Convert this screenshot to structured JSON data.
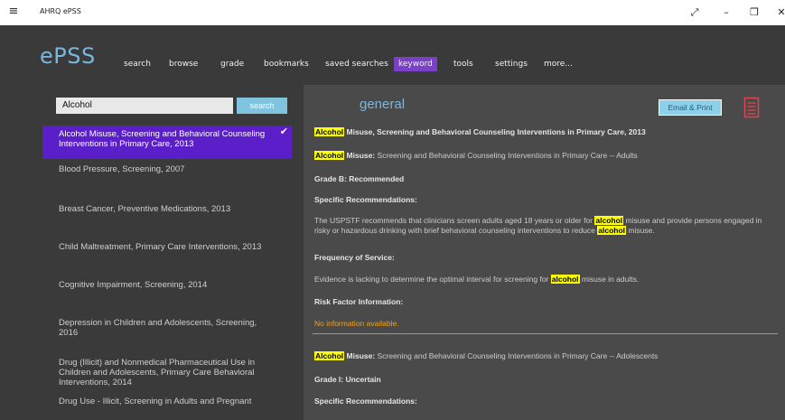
{
  "window": {
    "title": "AHRQ ePSS",
    "menu_glyph": "≡",
    "controls": {
      "expand": "⤢",
      "minimize": "–",
      "restore": "❐",
      "close": "✕"
    }
  },
  "app": {
    "logo": "ePSS",
    "nav": [
      "search",
      "browse",
      "grade",
      "bookmarks",
      "saved searches",
      "keyword",
      "tools",
      "settings",
      "more..."
    ],
    "active_nav": "keyword"
  },
  "search": {
    "value": "Alcohol",
    "button_label": "search"
  },
  "results": [
    {
      "title": "Alcohol Misuse, Screening and Behavioral Counseling Interventions in Primary Care, 2013",
      "selected": true
    },
    {
      "title": "Blood Pressure, Screening, 2007",
      "selected": false
    },
    {
      "title": "Breast Cancer, Preventive Medications, 2013",
      "selected": false
    },
    {
      "title": "Child Maltreatment, Primary Care Interventions, 2013",
      "selected": false
    },
    {
      "title": "Cognitive Impairment, Screening, 2014",
      "selected": false
    },
    {
      "title": "Depression in Children and Adolescents, Screening, 2016",
      "selected": false
    },
    {
      "title": "Drug (Illicit) and Nonmedical Pharmaceutical Use in Children and Adolescents, Primary Care Behavioral Interventions, 2014",
      "selected": false
    },
    {
      "title": "Drug Use - Illicit, Screening in Adults and Pregnant",
      "selected": false
    }
  ],
  "detail": {
    "section_title": "general",
    "email_print_label": "Email & Print",
    "keyword": "Alcohol",
    "keyword_lower": "alcohol",
    "heading_rest": " Misuse, Screening and Behavioral Counseling Interventions in Primary Care, 2013",
    "adults": {
      "label_rest": " Misuse:",
      "text": " Screening and Behavioral Counseling Interventions in Primary Care -- Adults",
      "grade": "Grade B: Recommended",
      "spec_label": "Specific Recommendations:",
      "spec_pre": "The USPSTF recommends that clinicians screen adults aged 18 years or older for ",
      "spec_mid": " misuse and provide persons engaged in risky or hazardous drinking with brief behavioral counseling interventions to reduce ",
      "spec_post": " misuse.",
      "freq_label": "Frequency of Service:",
      "freq_pre": "Evidence is lacking to determine the optimal interval for screening for ",
      "freq_post": " misuse in adults.",
      "risk_label": "Risk Factor Information:",
      "risk_text": "No information available."
    },
    "adolescents": {
      "label_rest": " Misuse:",
      "text": " Screening and Behavioral Counseling Interventions in Primary Care -- Adolescents",
      "grade": "Grade I: Uncertain",
      "spec_label": "Specific Recommendations:"
    }
  },
  "colors": {
    "accent_blue": "#7ab7e0",
    "selected_purple": "#5a1fc9",
    "nav_active_purple": "#7a40c8",
    "highlight": "#ffff00",
    "bookmark_red": "#e0454e",
    "warning_orange": "#f0a020"
  }
}
